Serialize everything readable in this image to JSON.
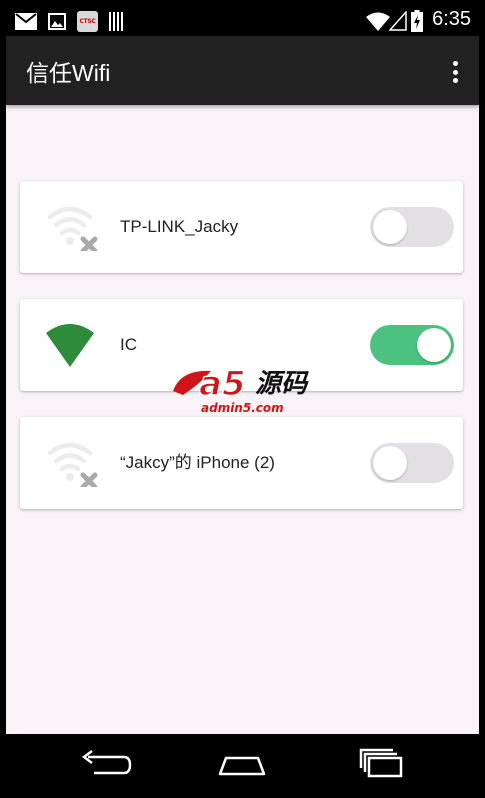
{
  "status_bar": {
    "carrier_badge": "CTSC",
    "time": "6:35",
    "icons": [
      "mail-icon",
      "image-icon",
      "carrier-icon",
      "barcode-icon",
      "wifi-icon",
      "signal-icon",
      "battery-icon"
    ]
  },
  "toolbar": {
    "title": "信任Wifi",
    "menu_icon": "overflow-menu-icon"
  },
  "networks": [
    {
      "name": "TP-LINK_Jacky",
      "enabled": false,
      "icon": "wifi-disconnected-icon"
    },
    {
      "name": "IC",
      "enabled": true,
      "icon": "wifi-connected-icon"
    },
    {
      "name": "“Jakcy”的 iPhone (2)",
      "enabled": false,
      "icon": "wifi-disconnected-icon"
    }
  ],
  "watermark": {
    "logo": "a5",
    "text": "源码",
    "url": "admin5.com"
  },
  "colors": {
    "toolbar": "#212121",
    "background": "#f7f3f6",
    "switch_on": "#4bc27f",
    "switch_off": "#e2e0e3",
    "wifi_connected": "#2e8b3a"
  },
  "nav_bar": {
    "icons": [
      "back-icon",
      "home-icon",
      "recents-icon"
    ]
  }
}
